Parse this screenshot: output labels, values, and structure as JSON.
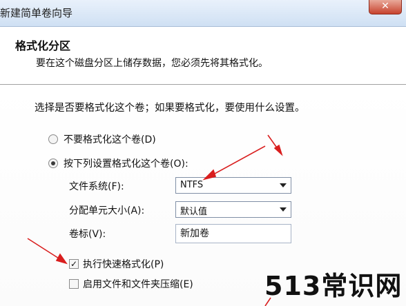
{
  "window": {
    "title": "新建简单卷向导",
    "close_glyph": "✕"
  },
  "header": {
    "title": "格式化分区",
    "subtitle": "要在这个磁盘分区上储存数据，您必须先将其格式化。"
  },
  "prompt": "选择是否要格式化这个卷；如果要格式化，要使用什么设置。",
  "options": {
    "no_format": {
      "label": "不要格式化这个卷(D)",
      "selected": false
    },
    "format": {
      "label": "按下列设置格式化这个卷(O):",
      "selected": true
    }
  },
  "fields": {
    "filesystem": {
      "label": "文件系统(F):",
      "value": "NTFS"
    },
    "allocation": {
      "label": "分配单元大小(A):",
      "value": "默认值"
    },
    "volume_label": {
      "label": "卷标(V):",
      "value": "新加卷"
    }
  },
  "checks": {
    "quick_format": {
      "label": "执行快速格式化(P)",
      "checked": true,
      "mark": "✓"
    },
    "compression": {
      "label": "启用文件和文件夹压缩(E)",
      "checked": false
    }
  },
  "watermark": "513常识网",
  "colors": {
    "arrow": "#d91e1e"
  }
}
